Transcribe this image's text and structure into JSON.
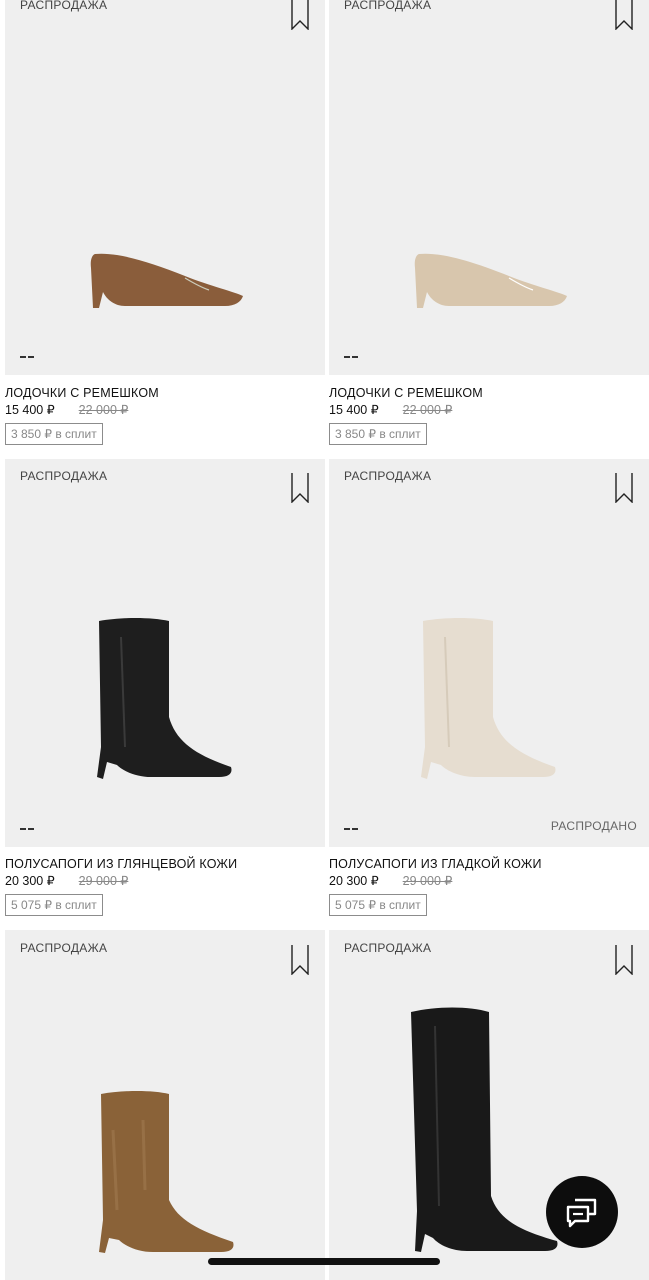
{
  "products": [
    {
      "badge": "РАСПРОДАЖА",
      "name": "ЛОДОЧКИ С РЕМЕШКОМ",
      "price": "15 400 ₽",
      "old_price": "22 000 ₽",
      "split": "3 850 ₽ в сплит",
      "color_hex": "#8a5d3b",
      "shoe_type": "pump"
    },
    {
      "badge": "РАСПРОДАЖА",
      "name": "ЛОДОЧКИ С РЕМЕШКОМ",
      "price": "15 400 ₽",
      "old_price": "22 000 ₽",
      "split": "3 850 ₽ в сплит",
      "color_hex": "#d8c6ad",
      "shoe_type": "pump"
    },
    {
      "badge": "РАСПРОДАЖА",
      "name": "ПОЛУСАПОГИ ИЗ ГЛЯНЦЕВОЙ КОЖИ",
      "price": "20 300 ₽",
      "old_price": "29 000 ₽",
      "split": "5 075 ₽ в сплит",
      "color_hex": "#1e1e1e",
      "shoe_type": "boot"
    },
    {
      "badge": "РАСПРОДАЖА",
      "name": "ПОЛУСАПОГИ ИЗ ГЛАДКОЙ КОЖИ",
      "price": "20 300 ₽",
      "old_price": "29 000 ₽",
      "split": "5 075 ₽ в сплит",
      "status": "РАСПРОДАНО",
      "color_hex": "#e6ddd0",
      "shoe_type": "boot"
    },
    {
      "badge": "РАСПРОДАЖА",
      "color_hex": "#8a6238",
      "shoe_type": "suede-boot"
    },
    {
      "badge": "РАСПРОДАЖА",
      "color_hex": "#191919",
      "shoe_type": "tall-boot"
    }
  ],
  "icons": {
    "bookmark": "bookmark-icon",
    "chat": "chat-support-icon",
    "swatches": "color-swatch-icon"
  }
}
